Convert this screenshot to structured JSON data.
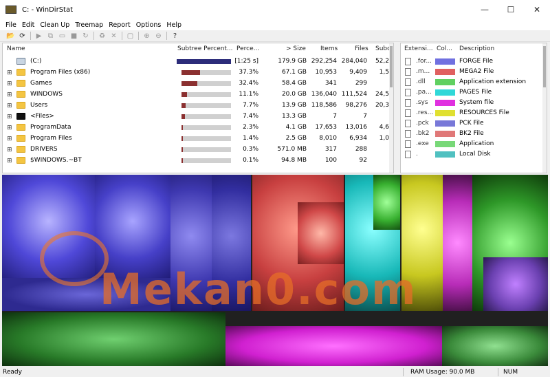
{
  "window": {
    "title": "C: - WinDirStat",
    "minimize": "—",
    "maximize": "☐",
    "close": "✕"
  },
  "menu": [
    "File",
    "Edit",
    "Clean Up",
    "Treemap",
    "Report",
    "Options",
    "Help"
  ],
  "tree": {
    "columns": [
      "Name",
      "Subtree Percent...",
      "Perce...",
      "> Size",
      "Items",
      "Files",
      "Subc"
    ],
    "rows": [
      {
        "name": "(C:)",
        "percent_text": "[1:25 s]",
        "size": "179.9 GB",
        "items": "292,254",
        "files": "284,040",
        "subdirs": "52,2",
        "expander": "",
        "root": true
      },
      {
        "name": "Program Files (x86)",
        "percent": 37.3,
        "percent_text": "37.3%",
        "size": "67.1 GB",
        "items": "10,953",
        "files": "9,409",
        "subdirs": "1,5",
        "expander": "⊞"
      },
      {
        "name": "Games",
        "percent": 32.4,
        "percent_text": "32.4%",
        "size": "58.4 GB",
        "items": "341",
        "files": "299",
        "subdirs": "",
        "expander": "⊞"
      },
      {
        "name": "WINDOWS",
        "percent": 11.1,
        "percent_text": "11.1%",
        "size": "20.0 GB",
        "items": "136,040",
        "files": "111,524",
        "subdirs": "24,5",
        "expander": "⊞"
      },
      {
        "name": "Users",
        "percent": 7.7,
        "percent_text": "7.7%",
        "size": "13.9 GB",
        "items": "118,586",
        "files": "98,276",
        "subdirs": "20,3",
        "expander": "⊞"
      },
      {
        "name": "<Files>",
        "percent": 7.4,
        "percent_text": "7.4%",
        "size": "13.3 GB",
        "items": "7",
        "files": "7",
        "subdirs": "",
        "expander": "⊞",
        "files_node": true
      },
      {
        "name": "ProgramData",
        "percent": 2.3,
        "percent_text": "2.3%",
        "size": "4.1 GB",
        "items": "17,653",
        "files": "13,016",
        "subdirs": "4,6",
        "expander": "⊞"
      },
      {
        "name": "Program Files",
        "percent": 1.4,
        "percent_text": "1.4%",
        "size": "2.5 GB",
        "items": "8,010",
        "files": "6,934",
        "subdirs": "1,0",
        "expander": "⊞"
      },
      {
        "name": "DRIVERS",
        "percent": 0.3,
        "percent_text": "0.3%",
        "size": "571.0 MB",
        "items": "317",
        "files": "288",
        "subdirs": "",
        "expander": "⊞"
      },
      {
        "name": "$WINDOWS.~BT",
        "percent": 0.1,
        "percent_text": "0.1%",
        "size": "94.8 MB",
        "items": "100",
        "files": "92",
        "subdirs": "",
        "expander": "⊞"
      }
    ]
  },
  "extensions": {
    "columns": [
      "Extensi...",
      "Col...",
      "Description"
    ],
    "rows": [
      {
        "ext": ".for...",
        "color": "#7070e0",
        "desc": "FORGE File"
      },
      {
        "ext": ".m...",
        "color": "#e06060",
        "desc": "MEGA2 File"
      },
      {
        "ext": ".dll",
        "color": "#60d060",
        "desc": "Application extension"
      },
      {
        "ext": ".pa...",
        "color": "#30d8d8",
        "desc": "PAGES File"
      },
      {
        "ext": ".sys",
        "color": "#e030e0",
        "desc": "System file"
      },
      {
        "ext": ".res...",
        "color": "#e0e030",
        "desc": "RESOURCES File"
      },
      {
        "ext": ".pck",
        "color": "#7878d8",
        "desc": "PCK File"
      },
      {
        "ext": ".bk2",
        "color": "#e07878",
        "desc": "BK2 File"
      },
      {
        "ext": ".exe",
        "color": "#78d878",
        "desc": "Application"
      },
      {
        "ext": ".",
        "color": "#50c0c0",
        "desc": "Local Disk"
      }
    ]
  },
  "watermark": "Mekan0.com",
  "status": {
    "ready": "Ready",
    "ram": "RAM Usage:     90.0 MB",
    "num": "NUM"
  }
}
